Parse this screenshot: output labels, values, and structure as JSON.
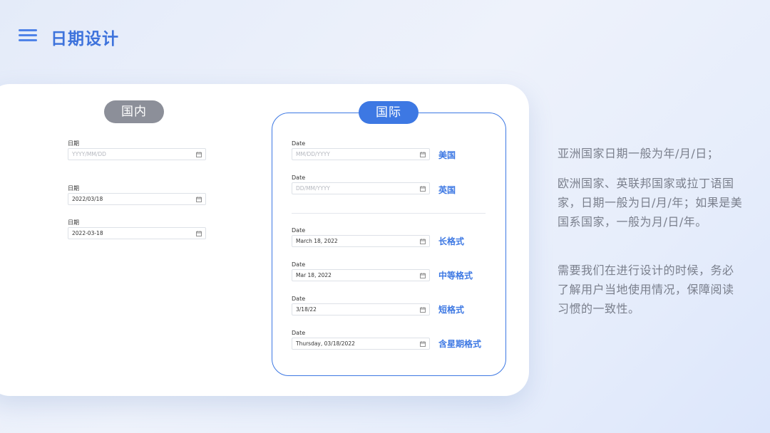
{
  "header": {
    "title": "日期设计"
  },
  "domestic": {
    "label": "国内",
    "fields": [
      {
        "label": "日期",
        "value": "YYYY/MM/DD",
        "placeholder": true
      },
      {
        "label": "日期",
        "value": "2022/03/18",
        "placeholder": false
      },
      {
        "label": "日期",
        "value": "2022-03-18",
        "placeholder": false
      }
    ]
  },
  "international": {
    "label": "国际",
    "fields": [
      {
        "label": "Date",
        "value": "MM/DD/YYYY",
        "placeholder": true,
        "tag": "美国"
      },
      {
        "label": "Date",
        "value": "DD/MM/YYYY",
        "placeholder": true,
        "tag": "英国"
      },
      {
        "label": "Date",
        "value": "March 18, 2022",
        "placeholder": false,
        "tag": "长格式"
      },
      {
        "label": "Date",
        "value": "Mar 18, 2022",
        "placeholder": false,
        "tag": "中等格式"
      },
      {
        "label": "Date",
        "value": "3/18/22",
        "placeholder": false,
        "tag": "短格式"
      },
      {
        "label": "Date",
        "value": "Thursday, 03/18/2022",
        "placeholder": false,
        "tag": "含星期格式"
      }
    ]
  },
  "description": {
    "p1": "亚洲国家日期一般为年/月/日；",
    "p2": "欧洲国家、英联邦国家或拉丁语国家，日期一般为日/月/年；如果是美国系国家，一般为月/日/年。",
    "p3": "需要我们在进行设计的时候，务必了解用户当地使用情况，保障阅读习惯的一致性。"
  },
  "colors": {
    "accent": "#3d78e3",
    "domestic_pill": "#8c8f99",
    "text_muted": "#7a7f8c"
  },
  "icons": {
    "menu": "hamburger-menu-icon",
    "calendar": "calendar-icon"
  }
}
